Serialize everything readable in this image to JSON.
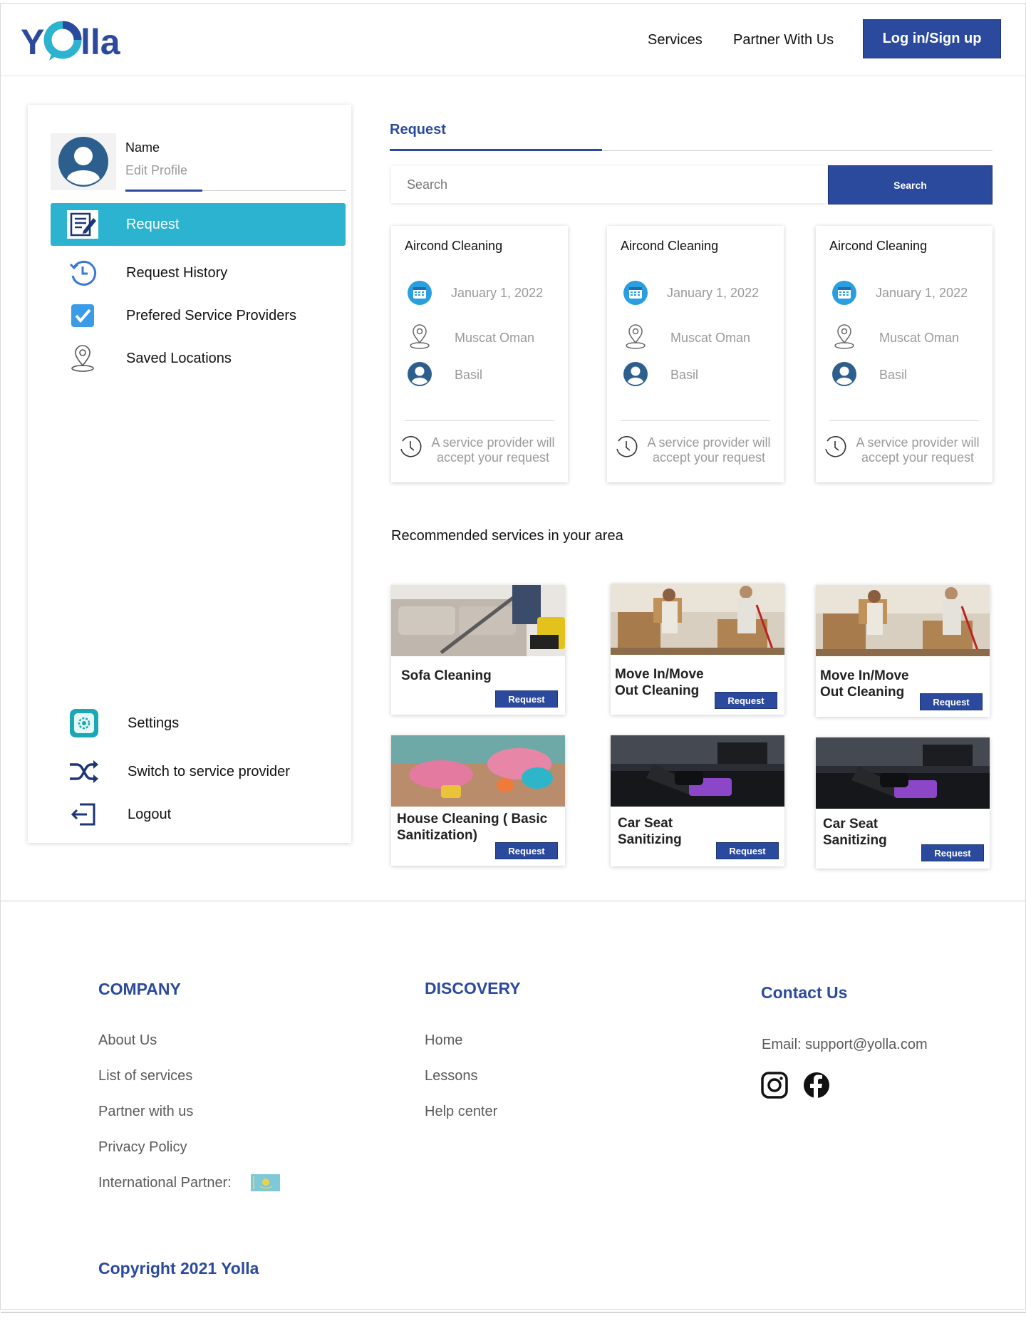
{
  "brand": {
    "logo_text": "Yolla",
    "primary_color": "#2b4a9e",
    "accent_color": "#2bb3cf"
  },
  "header": {
    "nav": [
      "Services",
      "Partner With Us"
    ],
    "login_label": "Log in/Sign up"
  },
  "sidebar": {
    "profile": {
      "name": "Name",
      "edit": "Edit Profile",
      "avatar_icon": "user-avatar-icon"
    },
    "items": [
      {
        "label": "Request",
        "icon": "request-form-icon",
        "active": true
      },
      {
        "label": "Request History",
        "icon": "history-icon"
      },
      {
        "label": "Prefered Service Providers",
        "icon": "checkbox-icon"
      },
      {
        "label": "Saved Locations",
        "icon": "location-pin-icon"
      }
    ],
    "bottom_items": [
      {
        "label": "Settings",
        "icon": "settings-icon"
      },
      {
        "label": "Switch to service provider",
        "icon": "shuffle-icon"
      },
      {
        "label": "Logout",
        "icon": "logout-icon"
      }
    ]
  },
  "main": {
    "tab": "Request",
    "search": {
      "placeholder": "Search",
      "button": "Search"
    },
    "requests": [
      {
        "title": "Aircond Cleaning",
        "date": "January 1, 2022",
        "location": "Muscat Oman",
        "person": "Basil",
        "status": "A service provider will accept your request"
      },
      {
        "title": "Aircond Cleaning",
        "date": "January 1, 2022",
        "location": "Muscat Oman",
        "person": "Basil",
        "status": "A service provider will accept your request"
      },
      {
        "title": "Aircond Cleaning",
        "date": "January 1, 2022",
        "location": "Muscat Oman",
        "person": "Basil",
        "status": "A service provider will accept your request"
      }
    ],
    "recommended_heading": "Recommended services in your area",
    "services": [
      {
        "name": "Sofa Cleaning",
        "button": "Request",
        "image": "sofa-cleaning-photo"
      },
      {
        "name": "Move In/Move Out Cleaning",
        "button": "Request",
        "image": "moving-boxes-photo"
      },
      {
        "name": "Move In/Move Out Cleaning",
        "button": "Request",
        "image": "moving-boxes-photo"
      },
      {
        "name": "House Cleaning ( Basic Sanitization)",
        "button": "Request",
        "image": "house-cleaning-photo"
      },
      {
        "name": "Car Seat Sanitizing",
        "button": "Request",
        "image": "car-seat-photo"
      },
      {
        "name": "Car Seat Sanitizing",
        "button": "Request",
        "image": "car-seat-photo"
      }
    ]
  },
  "footer": {
    "company": {
      "title": "COMPANY",
      "links": [
        "About Us",
        "List of services",
        "Partner with us",
        "Privacy Policy",
        "International Partner:"
      ]
    },
    "discovery": {
      "title": "DISCOVERY",
      "links": [
        "Home",
        "Lessons",
        "Help center"
      ]
    },
    "contact": {
      "title": "Contact Us",
      "email": "Email: support@yolla.com",
      "social": [
        "instagram-icon",
        "facebook-icon"
      ]
    },
    "copyright": "Copyright 2021 Yolla"
  }
}
